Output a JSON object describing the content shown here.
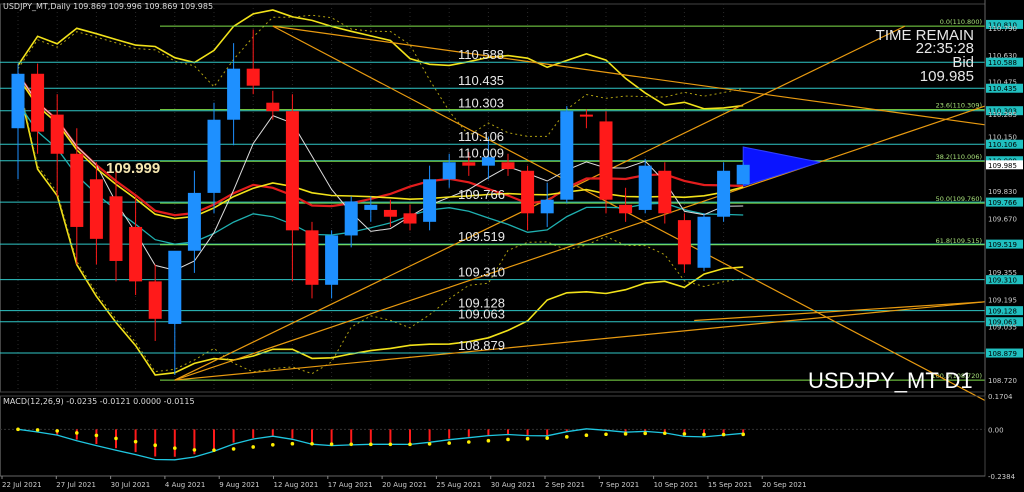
{
  "header": {
    "title": "USDJPY_MT,Daily",
    "ohlc": "109.869 109.996 109.869 109.985"
  },
  "info": {
    "time_remain_label": "TIME REMAIN",
    "time_remain": "22:35:28",
    "bid_label": "Bid",
    "bid": "109.985"
  },
  "symbol_watermark": "USDJPY_MT D1",
  "big_price": "109.999",
  "macd_header": "MACD(12,26,9) -0.0235 -0.0121 0.0000 -0.0115",
  "colors": {
    "bull": "#1e90ff",
    "bear": "#ff1a1a",
    "level": "#2fc6c6",
    "fib": "#7fe04a",
    "trend": "#e89a10",
    "band": "#f2e21a",
    "ma_red": "#e21d1d",
    "ma_white": "#dddddd",
    "ma_teal": "#1fb0b0",
    "macd_hist": "#1e7be8",
    "macd_signal": "#ffee00",
    "macd_line": "#1fc6e0",
    "triangle": "#0a14ff"
  },
  "chart_data": {
    "type": "candlestick",
    "instrument": "USDJPY_MT",
    "timeframe": "D1",
    "ylim": [
      108.65,
      110.93
    ],
    "y_ticks": [
      "110.810",
      "110.790",
      "110.630",
      "110.588",
      "110.475",
      "110.435",
      "110.303",
      "110.285",
      "110.150",
      "110.106",
      "110.009",
      "109.985",
      "109.830",
      "109.766",
      "109.670",
      "109.519",
      "109.355",
      "109.310",
      "109.195",
      "109.128",
      "109.063",
      "109.035",
      "108.879",
      "108.720"
    ],
    "y_tick_highlight": [
      "110.810",
      "110.588",
      "110.435",
      "110.303",
      "110.106",
      "110.009",
      "109.985",
      "109.766",
      "109.519",
      "109.310",
      "109.128",
      "109.063",
      "108.879"
    ],
    "x_labels": [
      "22 Jul 2021",
      "27 Jul 2021",
      "30 Jul 2021",
      "4 Aug 2021",
      "9 Aug 2021",
      "12 Aug 2021",
      "17 Aug 2021",
      "20 Aug 2021",
      "25 Aug 2021",
      "30 Aug 2021",
      "2 Sep 2021",
      "7 Sep 2021",
      "10 Sep 2021",
      "15 Sep 2021",
      "20 Sep 2021"
    ],
    "candles": [
      {
        "o": 110.2,
        "h": 110.58,
        "l": 109.9,
        "c": 110.52
      },
      {
        "o": 110.52,
        "h": 110.58,
        "l": 110.05,
        "c": 110.18
      },
      {
        "o": 110.28,
        "h": 110.4,
        "l": 109.8,
        "c": 110.05
      },
      {
        "o": 110.05,
        "h": 110.2,
        "l": 109.4,
        "c": 109.62
      },
      {
        "o": 109.9,
        "h": 110.0,
        "l": 109.4,
        "c": 109.55
      },
      {
        "o": 109.8,
        "h": 109.95,
        "l": 109.3,
        "c": 109.42
      },
      {
        "o": 109.62,
        "h": 109.8,
        "l": 109.22,
        "c": 109.3
      },
      {
        "o": 109.3,
        "h": 109.4,
        "l": 108.95,
        "c": 109.08
      },
      {
        "o": 109.05,
        "h": 109.45,
        "l": 108.75,
        "c": 109.48
      },
      {
        "o": 109.48,
        "h": 109.95,
        "l": 109.35,
        "c": 109.82
      },
      {
        "o": 109.82,
        "h": 110.35,
        "l": 109.7,
        "c": 110.25
      },
      {
        "o": 110.25,
        "h": 110.7,
        "l": 110.1,
        "c": 110.55
      },
      {
        "o": 110.55,
        "h": 110.78,
        "l": 110.4,
        "c": 110.45
      },
      {
        "o": 110.35,
        "h": 110.42,
        "l": 110.25,
        "c": 110.3
      },
      {
        "o": 110.3,
        "h": 110.4,
        "l": 109.3,
        "c": 109.6
      },
      {
        "o": 109.6,
        "h": 109.65,
        "l": 109.2,
        "c": 109.28
      },
      {
        "o": 109.28,
        "h": 109.6,
        "l": 109.2,
        "c": 109.57
      },
      {
        "o": 109.57,
        "h": 109.8,
        "l": 109.5,
        "c": 109.77
      },
      {
        "o": 109.72,
        "h": 109.8,
        "l": 109.65,
        "c": 109.75
      },
      {
        "o": 109.72,
        "h": 109.78,
        "l": 109.62,
        "c": 109.68
      },
      {
        "o": 109.7,
        "h": 109.75,
        "l": 109.6,
        "c": 109.64
      },
      {
        "o": 109.65,
        "h": 109.98,
        "l": 109.6,
        "c": 109.9
      },
      {
        "o": 109.9,
        "h": 110.05,
        "l": 109.85,
        "c": 110.0
      },
      {
        "o": 110.0,
        "h": 110.06,
        "l": 109.92,
        "c": 109.98
      },
      {
        "o": 109.98,
        "h": 110.15,
        "l": 109.9,
        "c": 110.03
      },
      {
        "o": 110.0,
        "h": 110.05,
        "l": 109.92,
        "c": 109.96
      },
      {
        "o": 109.95,
        "h": 109.98,
        "l": 109.6,
        "c": 109.7
      },
      {
        "o": 109.7,
        "h": 109.88,
        "l": 109.62,
        "c": 109.78
      },
      {
        "o": 109.78,
        "h": 110.33,
        "l": 109.76,
        "c": 110.3
      },
      {
        "o": 110.28,
        "h": 110.31,
        "l": 110.2,
        "c": 110.27
      },
      {
        "o": 110.24,
        "h": 110.3,
        "l": 109.7,
        "c": 109.78
      },
      {
        "o": 109.75,
        "h": 109.85,
        "l": 109.65,
        "c": 109.7
      },
      {
        "o": 109.72,
        "h": 110.02,
        "l": 109.7,
        "c": 109.98
      },
      {
        "o": 109.95,
        "h": 110.0,
        "l": 109.64,
        "c": 109.7
      },
      {
        "o": 109.66,
        "h": 109.7,
        "l": 109.35,
        "c": 109.4
      },
      {
        "o": 109.38,
        "h": 109.7,
        "l": 109.36,
        "c": 109.68
      },
      {
        "o": 109.68,
        "h": 110.0,
        "l": 109.65,
        "c": 109.95
      },
      {
        "o": 109.87,
        "h": 110.0,
        "l": 109.87,
        "c": 109.985
      }
    ],
    "horizontal_levels": [
      110.588,
      110.435,
      110.303,
      110.106,
      110.009,
      109.766,
      109.519,
      109.31,
      109.128,
      109.063,
      108.879
    ],
    "fibonacci": [
      {
        "label": "0.0(110.800)",
        "value": 110.8
      },
      {
        "label": "23.6(110.309)",
        "value": 110.309
      },
      {
        "label": "38.2(110.006)",
        "value": 110.006
      },
      {
        "label": "50.0(109.760)",
        "value": 109.76
      },
      {
        "label": "61.8(109.515)",
        "value": 109.515
      },
      {
        "label": "100.0(108.720)",
        "value": 108.72
      }
    ],
    "macd": {
      "params": "12,26,9",
      "values": [
        -0.0235,
        -0.0121,
        0.0,
        -0.0115
      ],
      "ylim": [
        -0.2384,
        0.1704
      ],
      "y_ticks": [
        "0.1704",
        "0.00",
        "-0.2384"
      ]
    }
  }
}
